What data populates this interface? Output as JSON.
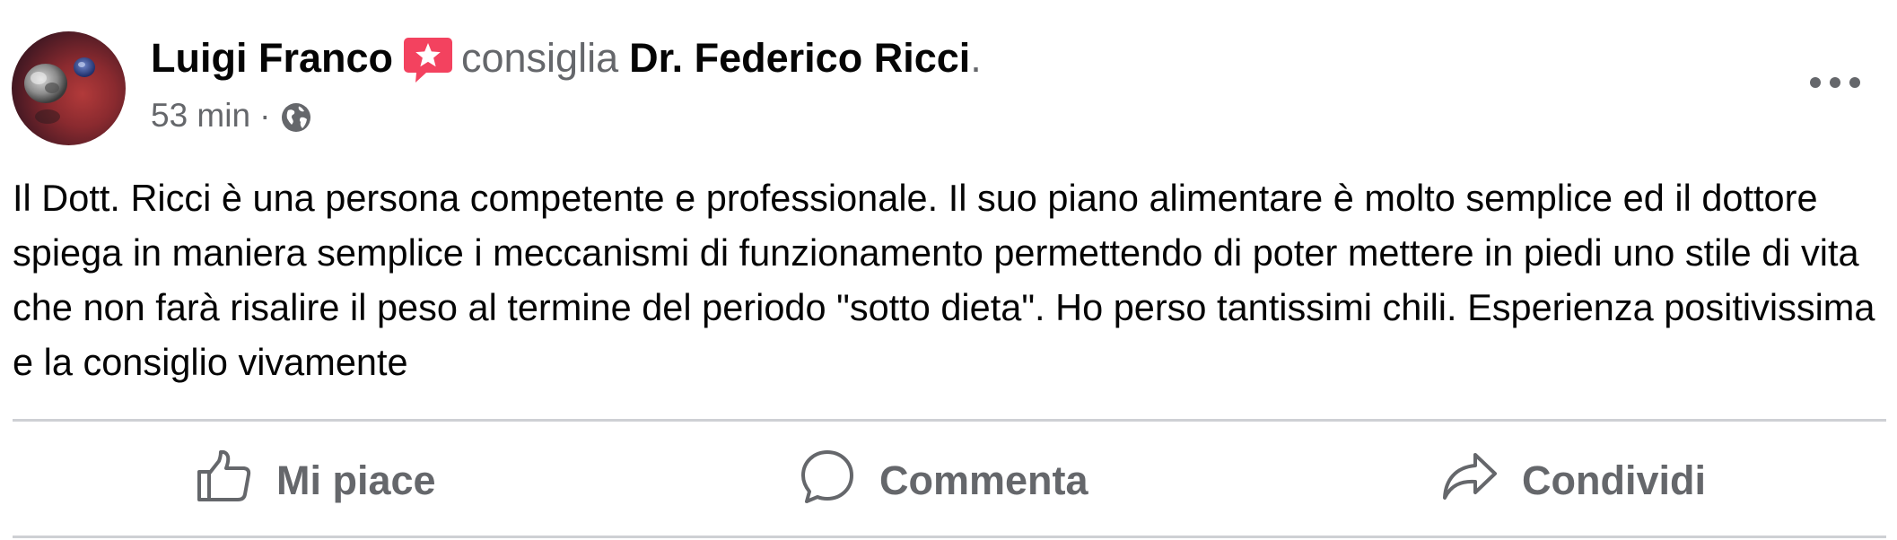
{
  "post": {
    "author_name": "Luigi Franco",
    "recommend_verb": "consiglia",
    "recommended_target": "Dr. Federico Ricci",
    "target_period": ".",
    "timestamp": "53 min",
    "meta_separator": "·",
    "audience_icon": "globe-icon",
    "more_icon": "more-options-icon",
    "text": "Il Dott. Ricci è una persona competente e professionale. Il suo piano alimentare è molto semplice ed il dottore spiega in maniera semplice i meccanismi di funzionamento permettendo di poter mettere in piedi uno stile di vita che non farà risalire il peso al termine del periodo \"sotto dieta\". Ho perso tantissimi chili. Esperienza positivissima e la consiglio vivamente"
  },
  "actions": {
    "like_label": "Mi piace",
    "comment_label": "Commenta",
    "share_label": "Condividi"
  },
  "colors": {
    "primary_text": "#050505",
    "secondary_text": "#65676b",
    "divider": "#ced0d4",
    "recommend_badge": "#f3425f"
  }
}
